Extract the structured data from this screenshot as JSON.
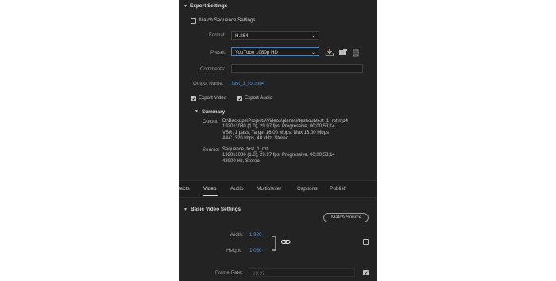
{
  "export_settings": {
    "header": "Export Settings",
    "match_sequence_label": "Match Sequence Settings",
    "format_label": "Format:",
    "format_value": "H.264",
    "preset_label": "Preset:",
    "preset_value": "YouTube 1080p HD",
    "comments_label": "Comments:",
    "comments_value": "",
    "output_name_label": "Output Name:",
    "output_name_value": "test_1_rot.mp4",
    "export_video_label": "Export Video",
    "export_audio_label": "Export Audio",
    "export_video_checked": true,
    "export_audio_checked": true,
    "match_sequence_checked": false
  },
  "summary": {
    "header": "Summary",
    "output_label": "Output:",
    "output_lines": [
      "D:\\Backups\\Projects\\Videos\\planets\\test\\out\\test_1_rot.mp4",
      "1920x1080 (1.0), 29.97 fps, Progressive, 00;00;53;14",
      "VBR, 1 pass, Target 16.00 Mbps, Max 16.00 Mbps",
      "AAC, 320 kbps, 48 kHz, Stereo"
    ],
    "source_label": "Source:",
    "source_lines": [
      "Sequence, test_1_rot",
      "1920x1080 (1.0), 29.97 fps, Progressive, 00;00;53;14",
      "48000 Hz, Stereo"
    ]
  },
  "tabs": [
    "fects",
    "Video",
    "Audio",
    "Multiplexer",
    "Captions",
    "Publish"
  ],
  "active_tab": "Video",
  "video": {
    "header": "Basic Video Settings",
    "match_source_label": "Match Source",
    "width_label": "Width:",
    "width_value": "1,920",
    "height_label": "Height:",
    "height_value": "1,080",
    "frame_rate_label": "Frame Rate:",
    "frame_rate_value": "29.97",
    "frame_rate_checked": true,
    "dimension_checkbox_checked": false
  },
  "colors": {
    "panel_bg": "#232323",
    "accent_blue": "#4a9be8",
    "text": "#c9c9c9"
  },
  "icons": [
    "collapse-caret-icon",
    "save-preset-icon",
    "import-preset-icon",
    "delete-preset-icon",
    "chain-link-icon"
  ]
}
